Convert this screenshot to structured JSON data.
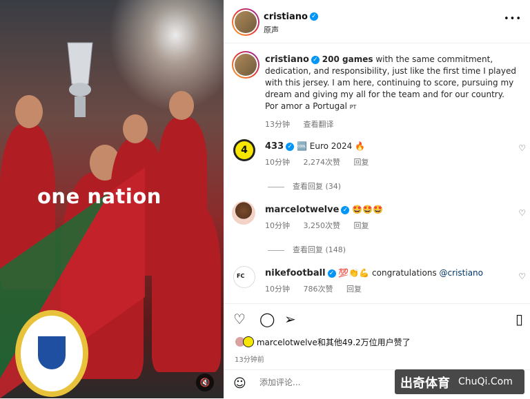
{
  "header": {
    "username": "cristiano",
    "subtitle": "原声",
    "more": "•••"
  },
  "media": {
    "overlay_text": "one nation",
    "mute_icon": "speaker-muted-icon"
  },
  "caption": {
    "username": "cristiano",
    "bold": "200 games",
    "text": "with the same commitment, dedication, and responsibility, just like the first time I played with this jersey. I am here, continuing to score, pursuing my dream and giving my all for the team and for our country.",
    "line2": "Por amor a Portugal",
    "lang": "PT",
    "time": "13分钟",
    "translate": "查看翻译"
  },
  "comments": [
    {
      "username": "433",
      "avatar_text": "4",
      "emoji_badge": "🆒",
      "text": "Euro 2024",
      "emoji": "🔥",
      "time": "10分钟",
      "likes": "2,274次赞",
      "reply": "回复",
      "view_replies": "查看回复 (34)"
    },
    {
      "username": "marcelotwelve",
      "emojis": "🤩🤩🤩",
      "time": "10分钟",
      "likes": "3,250次赞",
      "reply": "回复",
      "view_replies": "查看回复 (148)"
    },
    {
      "username": "nikefootball",
      "avatar_text": "FC",
      "emojis": "💯👏💪",
      "text": "congratulations",
      "mention": "@cristiano",
      "time": "10分钟",
      "likes": "786次赞",
      "reply": "回复"
    }
  ],
  "likes_summary": {
    "text": "marcelotwelve和其他49.2万位用户赞了",
    "time": "13分钟前"
  },
  "composer": {
    "placeholder": "添加评论...",
    "emoji_icon": "smiley-icon"
  },
  "watermark": {
    "cn": "出奇体育",
    "en": "ChuQi.Com"
  },
  "colors": {
    "accent": "#0095f6",
    "mention": "#00376b",
    "secondary": "#737373"
  }
}
